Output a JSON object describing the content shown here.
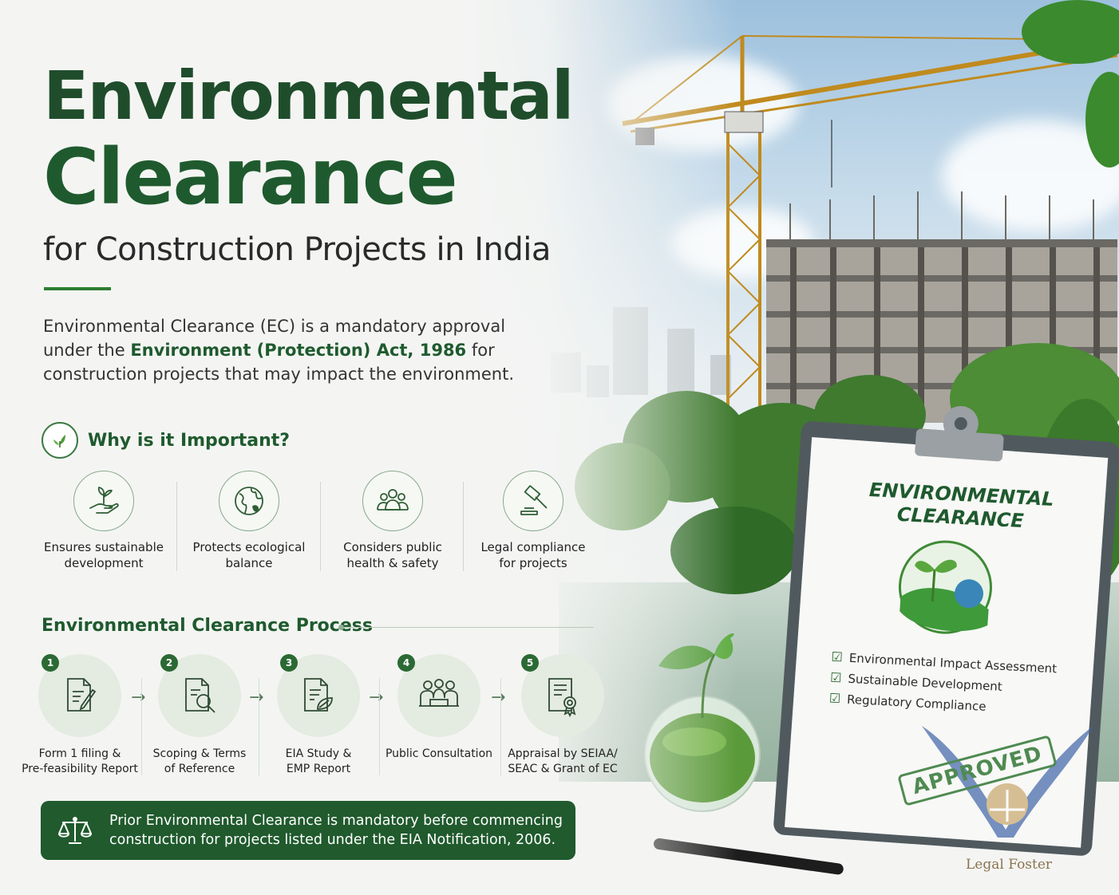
{
  "header": {
    "title_line1": "Environmental",
    "title_line2": "Clearance",
    "subtitle": "for Construction Projects in India"
  },
  "intro": {
    "text_before": "Environmental Clearance (EC) is a mandatory approval under the ",
    "highlight": "Environment (Protection) Act, 1986",
    "text_after": " for construction projects that may impact the environment."
  },
  "why": {
    "title": "Why is it Important?",
    "icon": "leaf-icon",
    "items": [
      {
        "line1": "Ensures sustainable",
        "line2": "development",
        "icon": "hand-plant-icon"
      },
      {
        "line1": "Protects ecological",
        "line2": "balance",
        "icon": "globe-icon"
      },
      {
        "line1": "Considers public",
        "line2": "health & safety",
        "icon": "people-icon"
      },
      {
        "line1": "Legal compliance",
        "line2": "for projects",
        "icon": "gavel-icon"
      }
    ]
  },
  "process": {
    "title": "Environmental Clearance Process",
    "steps": [
      {
        "num": "1",
        "line1": "Form 1 filing &",
        "line2": "Pre-feasibility Report",
        "icon": "form-edit-icon"
      },
      {
        "num": "2",
        "line1": "Scoping & Terms",
        "line2": "of Reference",
        "icon": "document-search-icon"
      },
      {
        "num": "3",
        "line1": "EIA Study &",
        "line2": "EMP Report",
        "icon": "document-leaf-icon"
      },
      {
        "num": "4",
        "line1": "Public Consultation",
        "line2": "",
        "icon": "meeting-icon"
      },
      {
        "num": "5",
        "line1": "Appraisal by SEIAA/",
        "line2": "SEAC & Grant of EC",
        "icon": "certificate-icon"
      }
    ]
  },
  "banner": {
    "line1": "Prior Environmental Clearance is mandatory before commencing",
    "line2": "construction for projects listed under the EIA Notification, 2006.",
    "icon": "scales-icon"
  },
  "clipboard": {
    "title_line1": "ENVIRONMENTAL",
    "title_line2": "CLEARANCE",
    "checklist": [
      "Environmental Impact Assessment",
      "Sustainable Development",
      "Regulatory Compliance"
    ],
    "stamp": "APPROVED"
  },
  "brand": "Legal Foster",
  "colors": {
    "primary": "#1f5a2e",
    "accent": "#2e7d32",
    "banner": "#205a2d"
  }
}
